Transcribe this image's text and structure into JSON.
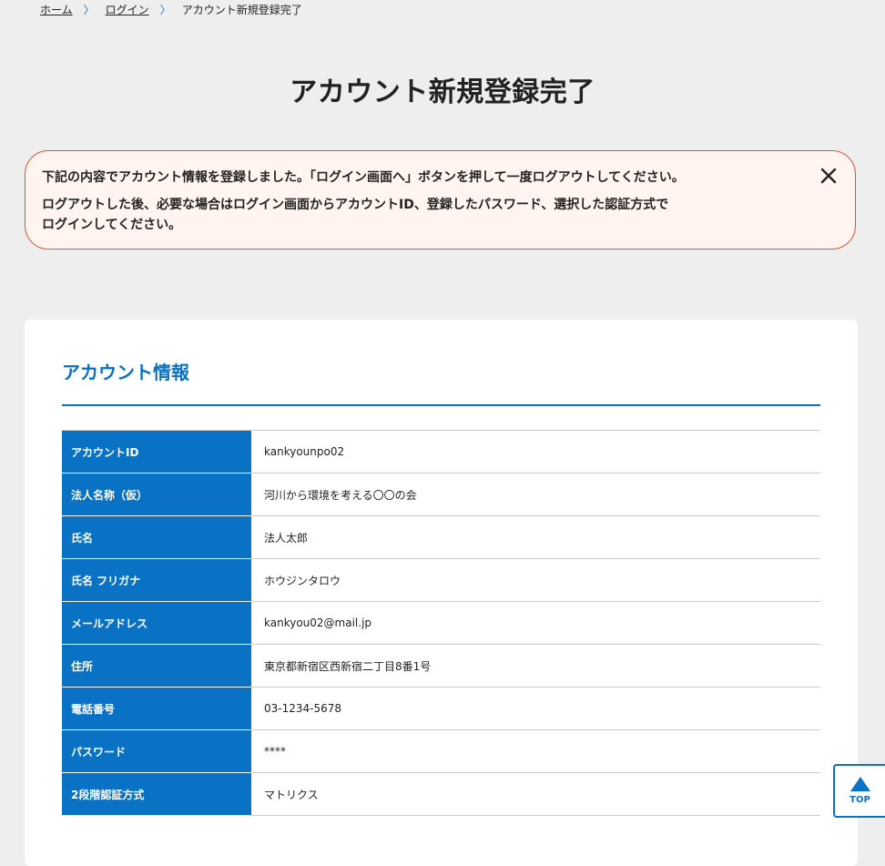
{
  "breadcrumb": {
    "home": "ホーム",
    "login": "ログイン",
    "current": "アカウント新規登録完了",
    "separator": "〉"
  },
  "page_title": "アカウント新規登録完了",
  "notice": {
    "line1": "下記の内容でアカウント情報を登録しました。「ログイン画面へ」ボタンを押して一度ログアウトしてください。",
    "line2": "ログアウトした後、必要な場合はログイン画面からアカウントID、登録したパスワード、選択した認証方式で",
    "line3": "ログインしてください。",
    "close_icon": "close-icon"
  },
  "account": {
    "heading": "アカウント情報",
    "rows": [
      {
        "label": "アカウントID",
        "value": "kankyounpo02"
      },
      {
        "label": "法人名称（仮）",
        "value": "河川から環境を考える〇〇の会"
      },
      {
        "label": "氏名",
        "value": "法人太郎"
      },
      {
        "label": "氏名 フリガナ",
        "value": "ホウジンタロウ"
      },
      {
        "label": "メールアドレス",
        "value": "kankyou02@mail.jp"
      },
      {
        "label": "住所",
        "value": "東京都新宿区西新宿二丁目8番1号"
      },
      {
        "label": "電話番号",
        "value": "03-1234-5678"
      },
      {
        "label": "パスワード",
        "value": "****"
      },
      {
        "label": "2段階認証方式",
        "value": "マトリクス"
      }
    ]
  },
  "top_button": {
    "label": "TOP",
    "icon": "triangle-up-icon"
  },
  "colors": {
    "accent": "#0a72c4",
    "notice_border": "#e2542e",
    "notice_bg": "#fff4f0",
    "page_bg": "#eeeeee"
  }
}
